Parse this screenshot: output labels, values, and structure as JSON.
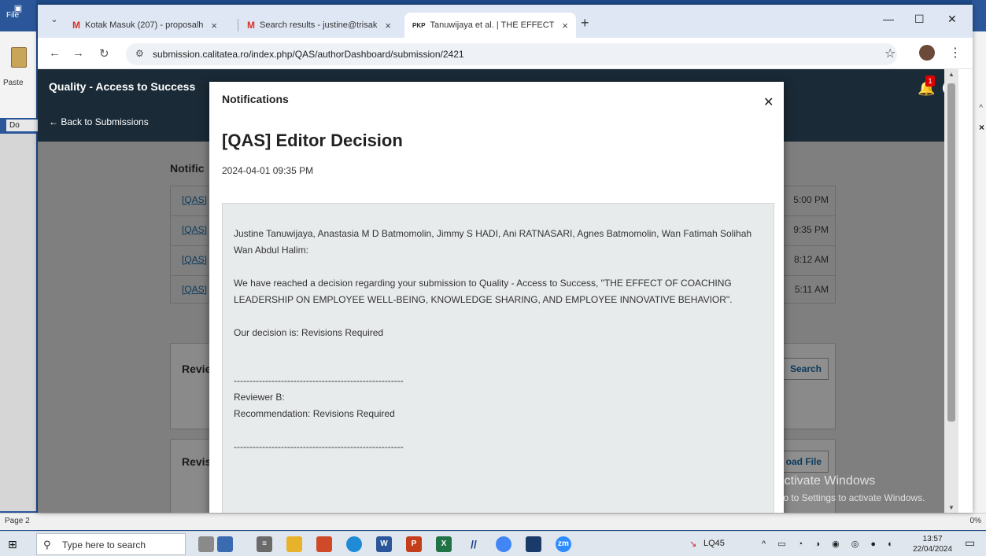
{
  "word": {
    "file_label": "File",
    "paste_label": "Paste",
    "doc_tab": "Do",
    "status_left": "Page 2",
    "status_right": "0%"
  },
  "browser": {
    "tabs": [
      {
        "favicon": "M",
        "label": "Kotak Masuk (207) - proposalh"
      },
      {
        "favicon": "M",
        "label": "Search results - justine@trisak"
      },
      {
        "favicon": "PKP",
        "label": "Tanuwijaya et al. | THE EFFECT"
      }
    ],
    "url": "submission.calitatea.ro/index.php/QAS/authorDashboard/submission/2421"
  },
  "ojs": {
    "site_title": "Quality - Access to Success",
    "back_link": "← Back to Submissions",
    "bell_count": "1",
    "bg_heading": "Notific",
    "bg_rows": [
      {
        "link": "[QAS]",
        "time": "5:00 PM"
      },
      {
        "link": "[QAS]",
        "time": "9:35 PM"
      },
      {
        "link": "[QAS]",
        "time": "8:12 AM"
      },
      {
        "link": "[QAS]",
        "time": "5:11 AM"
      }
    ],
    "card1_heading": "Revie",
    "card1_button": "Search",
    "card2_heading": "Revis",
    "card2_button": "oad File"
  },
  "modal": {
    "title": "Notifications",
    "heading": "[QAS] Editor Decision",
    "date": "2024-04-01 09:35 PM",
    "authors": "Justine Tanuwijaya, Anastasia M D Batmomolin, Jimmy S HADI, Ani RATNASARI, Agnes Batmomolin, Wan Fatimah Solihah Wan Abdul Halim:",
    "body": "We have reached a decision regarding your submission to Quality - Access to Success, \"THE EFFECT OF COACHING LEADERSHIP ON EMPLOYEE WELL-BEING, KNOWLEDGE SHARING, AND EMPLOYEE INNOVATIVE BEHAVIOR\".",
    "decision": "Our decision is: Revisions Required",
    "separator": "------------------------------------------------------",
    "reviewer": "Reviewer B:",
    "recommendation": "Recommendation: Revisions Required",
    "separator2": "------------------------------------------------------"
  },
  "watermark": {
    "line1": "Activate Windows",
    "line2": "Go to Settings to activate Windows."
  },
  "taskbar": {
    "search_placeholder": "Type here to search",
    "tray_label": "LQ45",
    "time": "13:57",
    "date": "22/04/2024"
  }
}
